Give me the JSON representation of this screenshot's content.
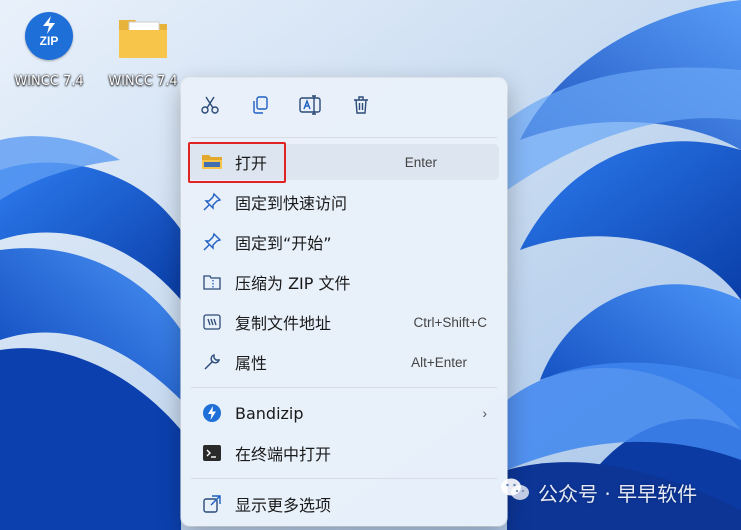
{
  "desktop": {
    "icons": [
      {
        "label": "WINCC 7.4",
        "icon": "zip-archive-icon",
        "badge": "ZIP"
      },
      {
        "label": "WINCC 7.4",
        "icon": "folder-icon"
      }
    ]
  },
  "menu": {
    "toolbar": [
      {
        "name": "cut-icon"
      },
      {
        "name": "copy-icon"
      },
      {
        "name": "rename-icon"
      },
      {
        "name": "delete-icon"
      }
    ],
    "items": [
      {
        "label": "打开",
        "shortcut": "Enter",
        "icon": "folder-open-icon"
      },
      {
        "label": "固定到快速访问",
        "shortcut": "",
        "icon": "pin-icon"
      },
      {
        "label": "固定到“开始”",
        "shortcut": "",
        "icon": "pin-icon"
      },
      {
        "label": "压缩为 ZIP 文件",
        "shortcut": "",
        "icon": "zip-folder-icon"
      },
      {
        "label": "复制文件地址",
        "shortcut": "Ctrl+Shift+C",
        "icon": "copy-path-icon"
      },
      {
        "label": "属性",
        "shortcut": "Alt+Enter",
        "icon": "wrench-icon"
      },
      {
        "label": "Bandizip",
        "shortcut": "",
        "icon": "bandizip-icon",
        "submenu": true
      },
      {
        "label": "在终端中打开",
        "shortcut": "",
        "icon": "terminal-icon"
      },
      {
        "label": "显示更多选项",
        "shortcut": "",
        "icon": "more-options-icon"
      }
    ]
  },
  "watermark": {
    "text": "公众号 · 早早软件"
  },
  "colors": {
    "accent": "#1f6fd9",
    "highlight_box": "#e02424",
    "wallpaper": "#1a5fd6"
  }
}
